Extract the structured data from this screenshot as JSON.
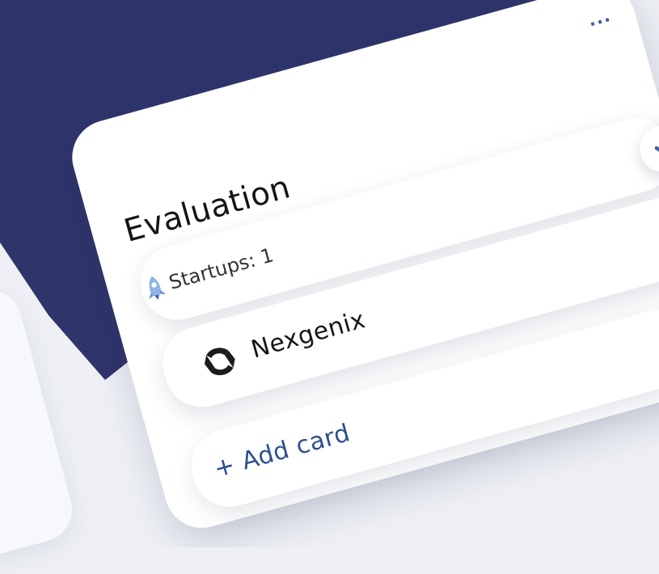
{
  "colors": {
    "backdrop": "#2f356b",
    "accent": "#3d5fa3",
    "text": "#141414"
  },
  "column": {
    "title": "Evaluation",
    "more_label": "...",
    "count_label": "Startups: 1",
    "status_icon": "check-icon",
    "count_icon": "rocket-icon"
  },
  "cards": [
    {
      "name": "Nexgenix",
      "logo_icon": "nexgenix-logo-icon"
    }
  ],
  "add_card": {
    "label": "+ Add card"
  }
}
